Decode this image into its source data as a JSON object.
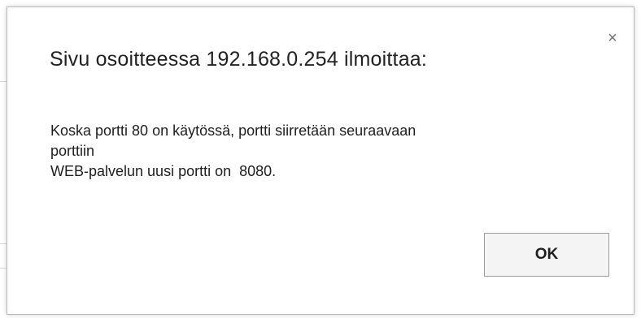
{
  "dialog": {
    "title": "Sivu osoitteessa 192.168.0.254 ilmoittaa:",
    "message_lines": [
      "Koska portti 80 on käytössä, portti siirretään seuraavaan",
      "porttiin",
      "WEB-palvelun uusi portti on  8080."
    ],
    "close_icon": "×",
    "ok_label": "OK"
  }
}
